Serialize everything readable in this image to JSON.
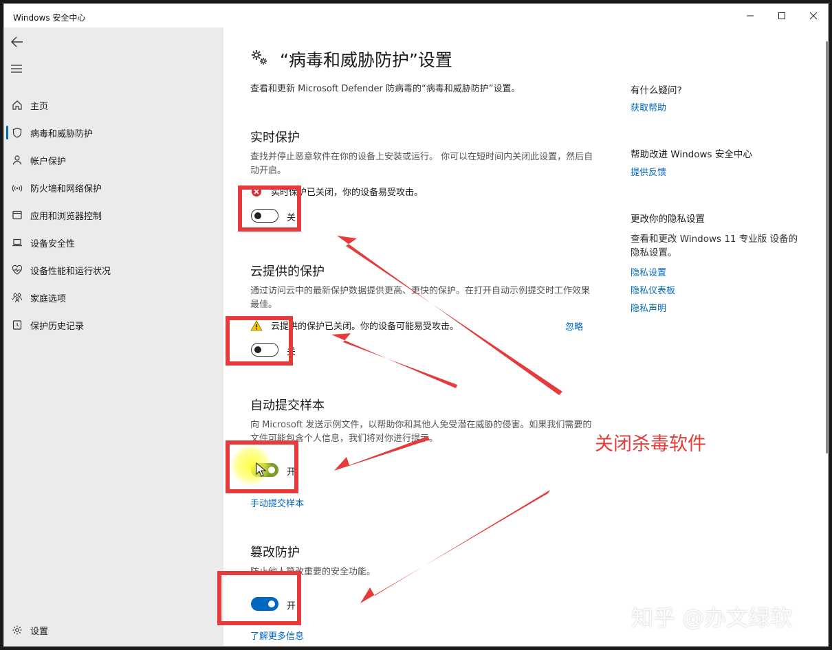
{
  "window": {
    "title": "Windows 安全中心"
  },
  "sidebar": {
    "items": [
      {
        "label": "主页",
        "icon": "home-icon"
      },
      {
        "label": "病毒和威胁防护",
        "icon": "shield-icon"
      },
      {
        "label": "帐户保护",
        "icon": "person-icon"
      },
      {
        "label": "防火墙和网络保护",
        "icon": "wifi-icon"
      },
      {
        "label": "应用和浏览器控制",
        "icon": "app-window-icon"
      },
      {
        "label": "设备安全性",
        "icon": "laptop-icon"
      },
      {
        "label": "设备性能和运行状况",
        "icon": "heart-pulse-icon"
      },
      {
        "label": "家庭选项",
        "icon": "family-icon"
      },
      {
        "label": "保护历史记录",
        "icon": "history-icon"
      }
    ],
    "settings_label": "设置"
  },
  "main": {
    "title": "“病毒和威胁防护”设置",
    "description": "查看和更新 Microsoft Defender 防病毒的“病毒和威胁防护”设置。",
    "sections": [
      {
        "title": "实时保护",
        "description": "查找并停止恶意软件在你的设备上安装或运行。 你可以在短时间内关闭此设置，然后自动开启。",
        "warning": "实时保护已关闭，你的设备易受攻击。",
        "toggle_state": "关"
      },
      {
        "title": "云提供的保护",
        "description": "通过访问云中的最新保护数据提供更高、更快的保护。在打开自动示例提交时工作效果最佳。",
        "warning": "云提供的保护已关闭。你的设备可能易受攻击。",
        "dismiss": "忽略",
        "toggle_state": "关"
      },
      {
        "title": "自动提交样本",
        "description": "向 Microsoft 发送示例文件，以帮助你和其他人免受潜在威胁的侵害。如果我们需要的文件可能包含个人信息，我们将对你进行提示。",
        "toggle_state": "开",
        "link": "手动提交样本"
      },
      {
        "title": "篡改防护",
        "description": "防止他人篡改重要的安全功能。",
        "toggle_state": "开",
        "link": "了解更多信息"
      }
    ]
  },
  "right": {
    "help_title": "有什么疑问?",
    "help_link": "获取帮助",
    "improve_title": "帮助改进 Windows 安全中心",
    "feedback_link": "提供反馈",
    "privacy_title": "更改你的隐私设置",
    "privacy_text": "查看和更改 Windows 11 专业版 设备的隐私设置。",
    "privacy_links": [
      "隐私设置",
      "隐私仪表板",
      "隐私声明"
    ]
  },
  "annotation": "关闭杀毒软件",
  "watermark": "知乎 @办文绿软",
  "colors": {
    "accent": "#0067c0",
    "annotation": "#e53b3b",
    "warning_red": "#d13438",
    "warning_yellow": "#f7c600"
  }
}
